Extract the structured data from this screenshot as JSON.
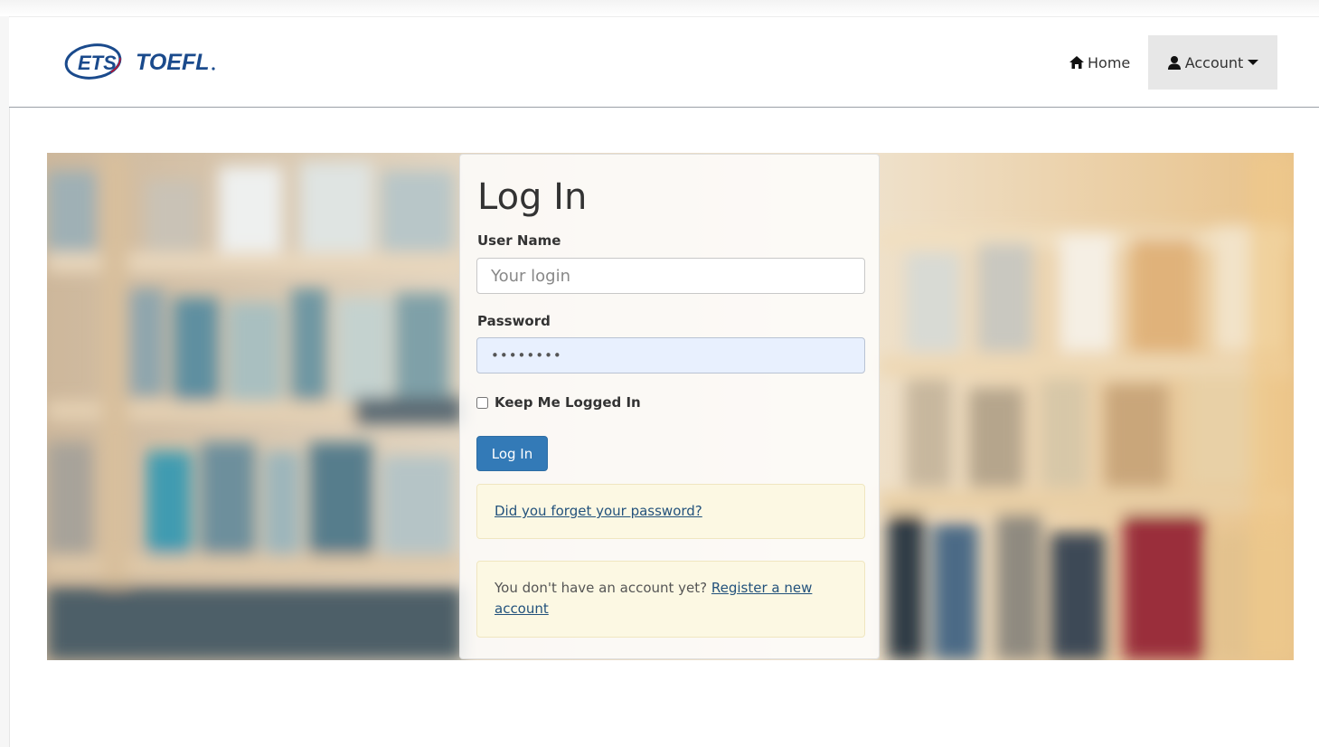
{
  "navbar": {
    "logo_ets": "ETS",
    "logo_toefl": "TOEFL",
    "home_label": "Home",
    "account_label": "Account"
  },
  "login": {
    "title": "Log In",
    "username_label": "User Name",
    "username_placeholder": "Your login",
    "password_label": "Password",
    "password_value": "password",
    "remember_label": "Keep Me Logged In",
    "submit_label": "Log In",
    "forgot_link": "Did you forget your password?",
    "register_prompt": "You don't have an account yet?",
    "register_link": "Register a new account"
  },
  "colors": {
    "primary": "#337ab7",
    "logo_blue": "#1a4a8c",
    "note_bg": "#fcf8e3",
    "link": "#23527c"
  }
}
